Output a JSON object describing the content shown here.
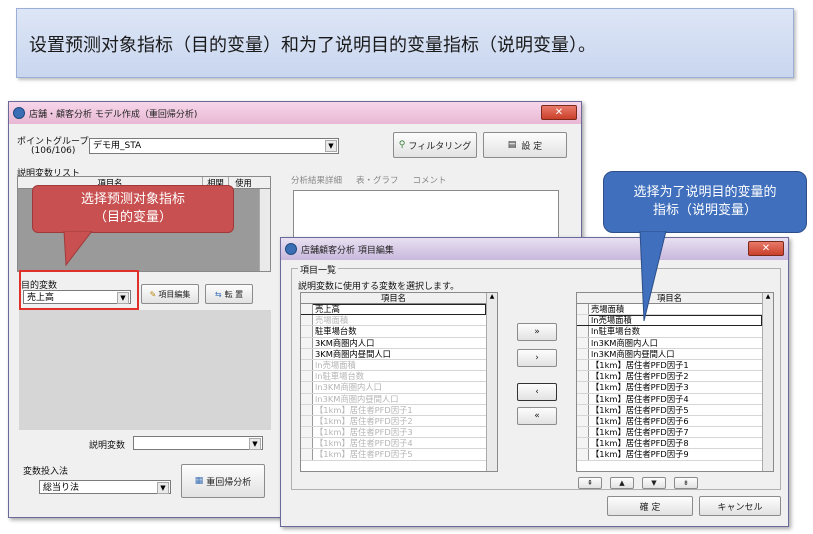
{
  "banner": {
    "text": "设置预测对象指标（目的变量）和为了说明目的变量指标（说明变量）。"
  },
  "main_window": {
    "title": "店舗・顧客分析 モデル作成（重回帰分析)",
    "point_group_label": "ポイントグループ:",
    "point_group_count": "(106/106)",
    "point_group_value": "デモ用_STA",
    "filter_button": "フィルタリング",
    "settings_button": "設 定",
    "explanatory_list_label": "説明変数リスト",
    "columns": [
      "項目名",
      "相関",
      "使用"
    ],
    "radio_options": [
      "分析結果詳細",
      "表・グラフ",
      "コメント"
    ],
    "target_label": "目的変数",
    "target_value": "売上高",
    "edit_items_button": "項目編集",
    "copy_button": "転 置",
    "explanatory_var_label": "説明変数",
    "input_method_label": "変数投入法",
    "input_method_value": "総当り法",
    "regression_button": "重回帰分析"
  },
  "red_callout": {
    "line1": "选择预测对象指标",
    "line2": "（目的变量）"
  },
  "blue_callout": {
    "line1": "选择为了说明目的变量的",
    "line2": "指标（说明变量）"
  },
  "dialog": {
    "title": "店舗顧客分析 項目編集",
    "group_label": "項目一覧",
    "instruction": "説明変数に使用する変数を選択します。",
    "column_header": "項目名",
    "left_items": [
      {
        "text": "売上高",
        "state": "sel"
      },
      {
        "text": "売場面積",
        "state": "dim"
      },
      {
        "text": "駐車場台数",
        "state": "normal"
      },
      {
        "text": "3KM商圏内人口",
        "state": "normal"
      },
      {
        "text": "3KM商圏内昼間人口",
        "state": "normal"
      },
      {
        "text": "ln売場面積",
        "state": "dim"
      },
      {
        "text": "ln駐車場台数",
        "state": "dim"
      },
      {
        "text": "ln3KM商圏内人口",
        "state": "dim"
      },
      {
        "text": "ln3KM商圏内昼間人口",
        "state": "dim"
      },
      {
        "text": "【1km】居住者PFD因子1",
        "state": "dim"
      },
      {
        "text": "【1km】居住者PFD因子2",
        "state": "dim"
      },
      {
        "text": "【1km】居住者PFD因子3",
        "state": "dim"
      },
      {
        "text": "【1km】居住者PFD因子4",
        "state": "dim"
      },
      {
        "text": "【1km】居住者PFD因子5",
        "state": "dim"
      }
    ],
    "right_items": [
      {
        "text": "売場面積",
        "state": "normal"
      },
      {
        "text": "ln売場面積",
        "state": "sel"
      },
      {
        "text": "ln駐車場台数",
        "state": "normal"
      },
      {
        "text": "ln3KM商圏内人口",
        "state": "normal"
      },
      {
        "text": "ln3KM商圏内昼間人口",
        "state": "normal"
      },
      {
        "text": "【1km】居住者PFD因子1",
        "state": "normal"
      },
      {
        "text": "【1km】居住者PFD因子2",
        "state": "normal"
      },
      {
        "text": "【1km】居住者PFD因子3",
        "state": "normal"
      },
      {
        "text": "【1km】居住者PFD因子4",
        "state": "normal"
      },
      {
        "text": "【1km】居住者PFD因子5",
        "state": "normal"
      },
      {
        "text": "【1km】居住者PFD因子6",
        "state": "normal"
      },
      {
        "text": "【1km】居住者PFD因子7",
        "state": "normal"
      },
      {
        "text": "【1km】居住者PFD因子8",
        "state": "normal"
      },
      {
        "text": "【1km】居住者PFD因子9",
        "state": "normal"
      }
    ],
    "move_buttons": [
      "»",
      "›",
      "‹",
      "«"
    ],
    "order_buttons": [
      "⇞",
      "▲",
      "▼",
      "⇟"
    ],
    "ok_button": "確 定",
    "cancel_button": "キャンセル"
  }
}
